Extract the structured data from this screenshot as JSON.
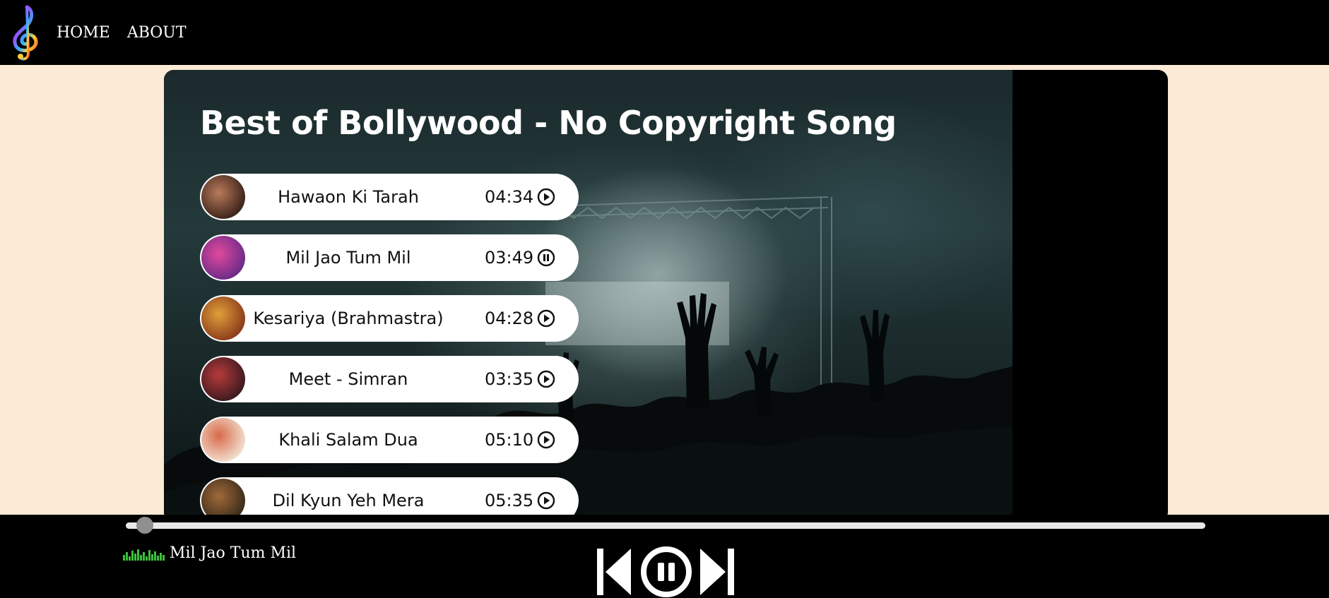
{
  "navbar": {
    "links": [
      "HOME",
      "ABOUT"
    ]
  },
  "playlist": {
    "title": "Best of Bollywood - No Copyright Song",
    "songs": [
      {
        "name": "Hawaon Ki Tarah",
        "duration": "04:34",
        "state": "play",
        "thumb_colors": [
          "#b97a5c",
          "#3a2218"
        ]
      },
      {
        "name": "Mil Jao Tum Mil",
        "duration": "03:49",
        "state": "pause",
        "thumb_colors": [
          "#e14a9b",
          "#6a2a8a"
        ]
      },
      {
        "name": "Kesariya (Brahmastra)",
        "duration": "04:28",
        "state": "play",
        "thumb_colors": [
          "#e0a03a",
          "#8a3a1a"
        ]
      },
      {
        "name": "Meet - Simran",
        "duration": "03:35",
        "state": "play",
        "thumb_colors": [
          "#b83a3a",
          "#3a1a20"
        ]
      },
      {
        "name": "Khali Salam Dua",
        "duration": "05:10",
        "state": "play",
        "thumb_colors": [
          "#d86a4a",
          "#f2e0d0"
        ]
      },
      {
        "name": "Dil Kyun Yeh Mera",
        "duration": "05:35",
        "state": "play",
        "thumb_colors": [
          "#a06a3a",
          "#3a2a1a"
        ]
      }
    ]
  },
  "player": {
    "now_playing": "Mil Jao Tum Mil",
    "progress": 0.01,
    "state": "playing",
    "controls": [
      "previous-icon",
      "pause-icon",
      "next-icon"
    ]
  },
  "colors": {
    "page_bg": "#fbebd6",
    "bar_bg": "#000000",
    "card_bg": "#ffffff",
    "eq_green": "#3fbf3f"
  }
}
